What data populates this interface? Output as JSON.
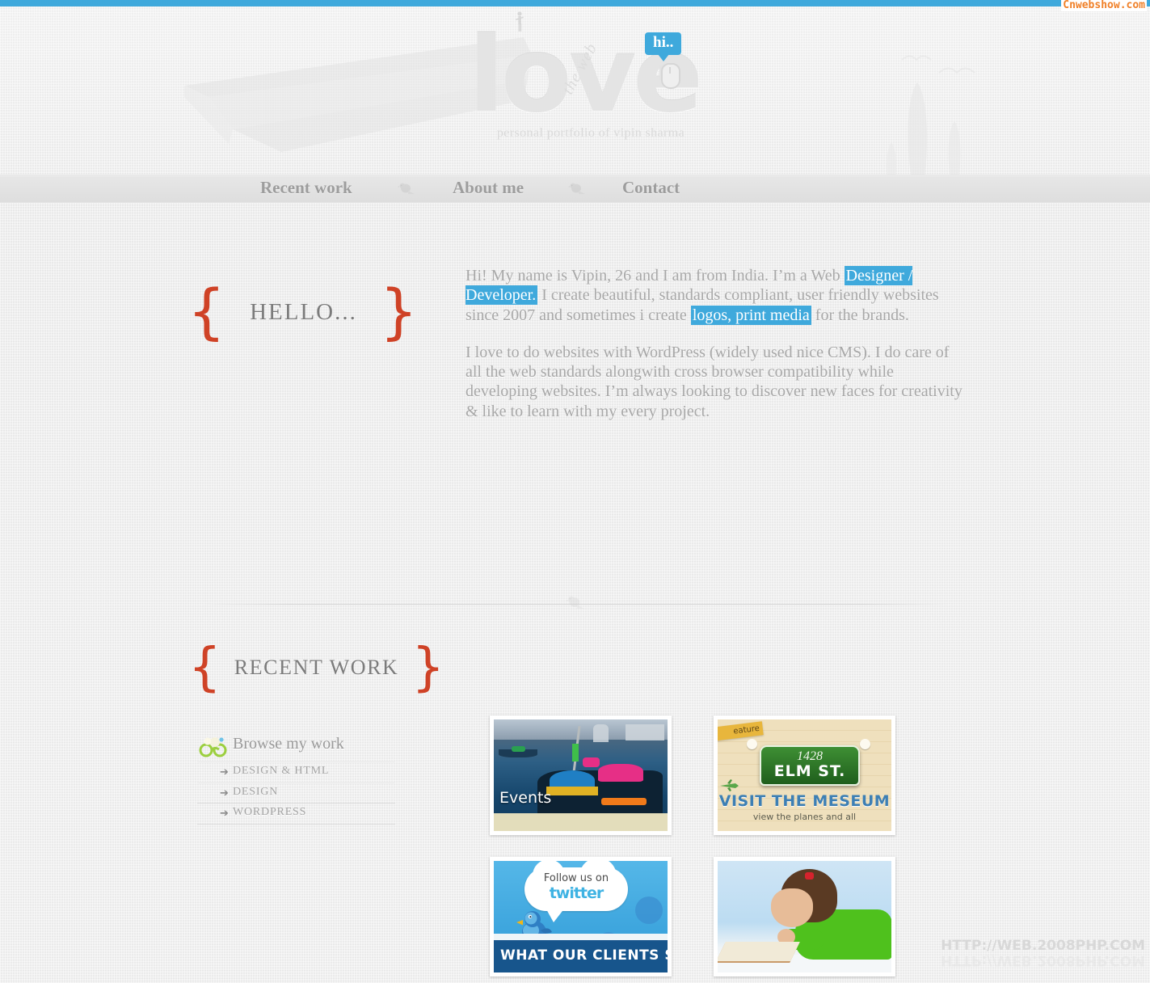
{
  "watermarks": {
    "top_right": "Cnwebshow.com",
    "bottom_right": "HTTP://WEB.2008PHP.COM"
  },
  "header": {
    "logo_word": "love",
    "logo_sub": "the web",
    "tagline": "personal portfolio of vipin sharma",
    "bubble": "hi..",
    "icons": {
      "mouse": "mouse-icon",
      "walker": "walking-person-icon",
      "road": "road-illustration",
      "trees": "cypress-trees-illustration",
      "birds": "flying-birds-illustration"
    }
  },
  "nav": {
    "items": [
      {
        "label": "Recent work"
      },
      {
        "label": "About me"
      },
      {
        "label": "Contact"
      }
    ],
    "separator_icon": "bird-icon"
  },
  "hello": {
    "brace_open": "{",
    "brace_close": "}",
    "title": "HELLO...",
    "paragraph1": {
      "part1": "Hi! My name is Vipin, 26 and I am from India. I’m a Web ",
      "highlight1": "Designer / Developer.",
      "part2": " I create beautiful, standards compliant, user friendly websites since 2007 and sometimes i create ",
      "highlight2": "logos, print media",
      "part3": " for the brands."
    },
    "paragraph2": "I love to do websites with WordPress (widely used nice CMS). I do care of all the web standards alongwith cross browser compatibility while developing websites. I’m always looking to discover new faces for creativity & like to learn with my every project."
  },
  "recent_work": {
    "brace_open": "{",
    "brace_close": "}",
    "title": "RECENT WORK",
    "browse_title": "Browse my work",
    "browse_icon": "glasses-icon",
    "filters": [
      {
        "label": "DESIGN & HTML",
        "arrow": "➔"
      },
      {
        "label": "DESIGN",
        "arrow": "➔"
      },
      {
        "label": "WORDPRESS",
        "arrow": "➔"
      }
    ],
    "thumbnails": [
      {
        "name": "events-boats-thumbnail",
        "caption": "Events"
      },
      {
        "name": "elm-st-museum-thumbnail",
        "tape": "eature",
        "sign_number": "1428",
        "sign_street": "ELM ST.",
        "headline": "VISIT THE MESEUM",
        "subline": "view the planes and all"
      },
      {
        "name": "twitter-clients-thumbnail",
        "cloud_line1": "Follow us on",
        "cloud_line2": "twitter",
        "banner": "WHAT OUR CLIENTS SAY"
      },
      {
        "name": "girl-reading-thumbnail",
        "caption": ""
      }
    ]
  },
  "colors": {
    "accent_blue": "#3fa9dc",
    "brace_red": "#cf4226",
    "page_bg": "#ededed",
    "text_gray": "#a8a8a8",
    "watermark_orange": "#f08028"
  }
}
